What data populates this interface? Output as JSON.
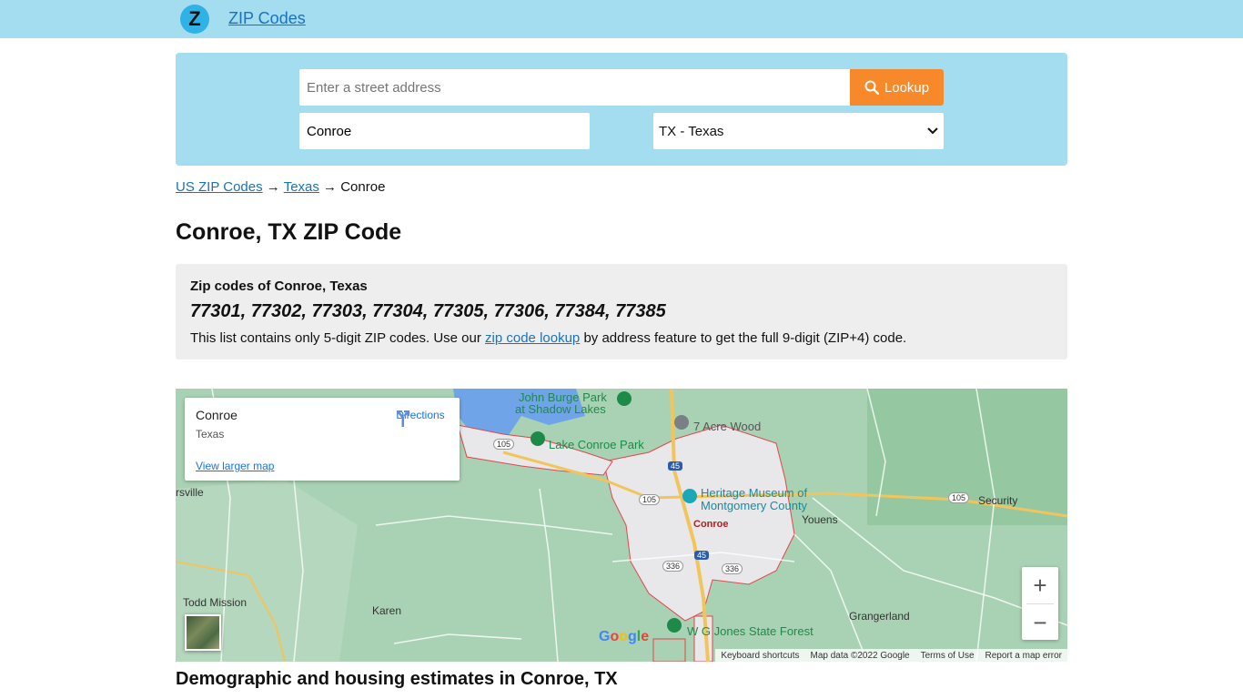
{
  "header": {
    "logo_letter": "Z",
    "brand": "ZIP Codes"
  },
  "search": {
    "address_placeholder": "Enter a street address",
    "address_value": "",
    "lookup_label": "Lookup",
    "city_value": "Conroe",
    "state_selected": "TX - Texas",
    "state_options": [
      "TX - Texas"
    ]
  },
  "breadcrumb": {
    "item1": "US ZIP Codes",
    "sep": "→",
    "item2": "Texas",
    "item3": "Conroe"
  },
  "page": {
    "title": "Conroe, TX ZIP Code"
  },
  "zips": {
    "label": "Zip codes of Conroe, Texas",
    "list": "77301, 77302, 77303, 77304, 77305, 77306, 77384, 77385",
    "note_before": "This list contains only 5-digit ZIP codes. Use our ",
    "note_link": "zip code lookup",
    "note_after": " by address feature to get the full 9-digit (ZIP+4) code."
  },
  "map": {
    "card_title": "Conroe",
    "card_sub": "Texas",
    "card_link": "View larger map",
    "directions": "Directions",
    "labels": {
      "john_burge_1": "John Burge Park",
      "john_burge_2": "at Shadow Lakes",
      "lake_conroe": "Lake Conroe Park",
      "seven_acre": "7 Acre Wood",
      "heritage_1": "Heritage Museum of",
      "heritage_2": "Montgomery County",
      "conroe": "Conroe",
      "youens": "Youens",
      "security": "Security",
      "rsville": "rsville",
      "todd": "Todd Mission",
      "karen": "Karen",
      "grangerland": "Grangerland",
      "wg_jones": "W G Jones State Forest",
      "hwy105a": "105",
      "hwy105b": "105",
      "hwy105c": "105",
      "i45a": "45",
      "i45b": "45",
      "hwy336a": "336",
      "hwy336b": "336"
    },
    "google": "Google",
    "attrib": {
      "keys": "Keyboard shortcuts",
      "data": "Map data ©2022 Google",
      "terms": "Terms of Use",
      "report": "Report a map error"
    },
    "zoom_in": "+",
    "zoom_out": "−"
  },
  "section": {
    "title": "Demographic and housing estimates in Conroe, TX"
  }
}
